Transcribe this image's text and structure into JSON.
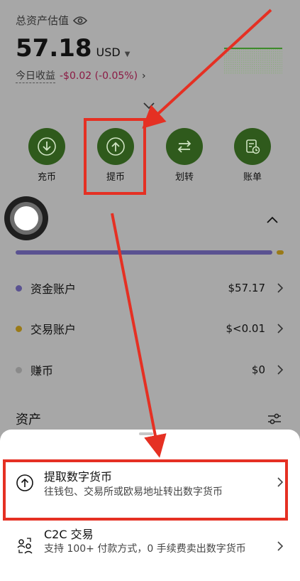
{
  "summary": {
    "total_label": "总资产估值",
    "balance": "57.18",
    "currency": "USD",
    "today_label": "今日收益",
    "today_value": "-$0.02 (-0.05%)"
  },
  "actions": [
    {
      "label": "充币",
      "icon": "download-circle-icon"
    },
    {
      "label": "提币",
      "icon": "upload-circle-icon"
    },
    {
      "label": "划转",
      "icon": "swap-arrows-icon"
    },
    {
      "label": "账单",
      "icon": "bill-clock-icon"
    }
  ],
  "distribution": {
    "funding_ratio": 0.98,
    "trading_ratio": 0.02
  },
  "accounts": [
    {
      "name": "资金账户",
      "amount": "$57.17",
      "color": "#5a5291"
    },
    {
      "name": "交易账户",
      "amount": "$<0.01",
      "color": "#9a7a17"
    },
    {
      "name": "赚币",
      "amount": "$0",
      "color": "#8a8a8a"
    }
  ],
  "assets_title": "资产",
  "sheet": {
    "options": [
      {
        "title": "提取数字货币",
        "desc": "往钱包、交易所或欧易地址转出数字货币",
        "icon": "upload-circle-icon"
      },
      {
        "title": "C2C 交易",
        "desc": "支持 100+ 付款方式，0 手续费卖出数字货币",
        "icon": "people-exchange-icon"
      }
    ]
  },
  "colors": {
    "accent": "#2f5a1c",
    "loss": "#8b1a44",
    "annotation": "#e53023"
  }
}
